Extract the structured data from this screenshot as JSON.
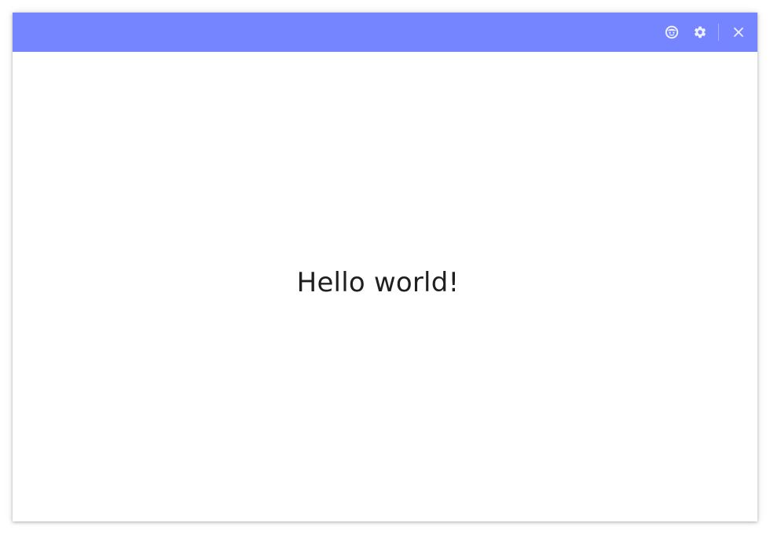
{
  "titlebar": {
    "background": "#7585ff",
    "icons": [
      "face-icon",
      "gear-icon",
      "close-icon"
    ]
  },
  "main": {
    "message": "Hello world!"
  }
}
